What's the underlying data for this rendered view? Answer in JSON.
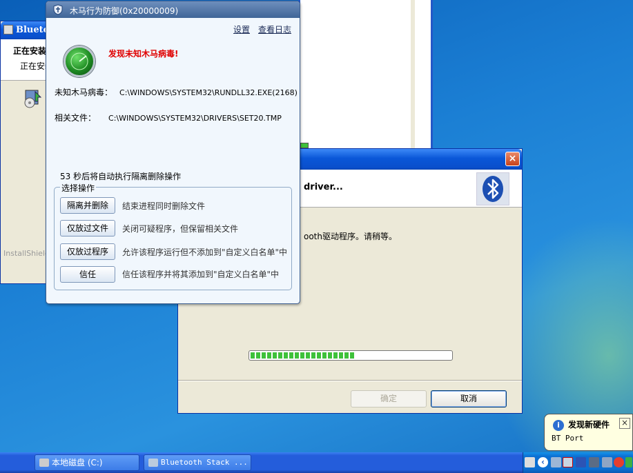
{
  "window_a": {
    "title": "Bluetooth",
    "header_bold": "正在安装",
    "header_sub": "正在安装",
    "brand": "InstallShield"
  },
  "driver_dialog": {
    "header_title": "driver...",
    "message": "ooth驱动程序。请稍等。",
    "progress_percent": 52,
    "ok_label": "确定",
    "cancel_label": "取消"
  },
  "av_popup": {
    "title": "木马行为防御(0x20000009)",
    "links": {
      "settings": "设置",
      "view_log": "查看日志"
    },
    "alert": "发现未知木马病毒!",
    "trojan_label": "未知木马病毒：",
    "trojan_value": "C:\\WINDOWS\\SYSTEM32\\RUNDLL32.EXE(2168)",
    "file_label": "相关文件：",
    "file_value": "C:\\WINDOWS\\SYSTEM32\\DRIVERS\\SET20.TMP",
    "countdown": "53 秒后将自动执行隔离删除操作",
    "group_label": "选择操作",
    "options": [
      {
        "button": "隔离并删除",
        "desc": "结束进程同时删除文件"
      },
      {
        "button": "仅放过文件",
        "desc": "关闭可疑程序，但保留相关文件"
      },
      {
        "button": "仅放过程序",
        "desc": "允许该程序运行但不添加到\"自定义白名单\"中"
      },
      {
        "button": "信任",
        "desc": "信任该程序并将其添加到\"自定义白名单\"中"
      }
    ]
  },
  "balloon": {
    "title": "发现新硬件",
    "body": "BT Port",
    "close": "×"
  },
  "taskbar": {
    "tasks": [
      {
        "label": "本地磁盘 (C:)"
      },
      {
        "label": "Bluetooth Stack ..."
      }
    ]
  },
  "colors": {
    "alert_red": "#e00000",
    "progress_green": "#3ec13a",
    "xp_blue": "#0a57d8"
  }
}
